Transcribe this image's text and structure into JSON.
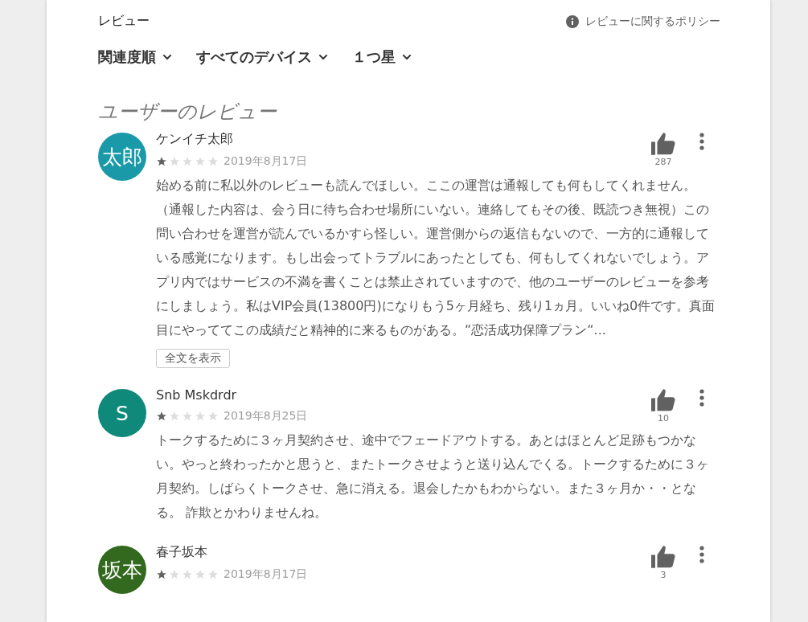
{
  "header": {
    "title": "レビュー",
    "policy_link": "レビューに関するポリシー"
  },
  "filters": [
    {
      "label": "関連度順"
    },
    {
      "label": "すべてのデバイス"
    },
    {
      "label": "１つ星"
    }
  ],
  "section_title": "ユーザーのレビュー",
  "reviews": [
    {
      "avatar_text": "太郎",
      "color": "#1a9aa9",
      "name": "ケンイチ太郎",
      "stars": 1,
      "date": "2019年8月17日",
      "likes": "287",
      "text": "始める前に私以外のレビューも読んでほしい。ここの運営は通報しても何もしてくれません。（通報した内容は、会う日に待ち合わせ場所にいない。連絡してもその後、既読つき無視）この問い合わせを運営が読んでいるかすら怪しい。運営側からの返信もないので、一方的に通報している感覚になります。もし出会ってトラブルにあったとしても、何もしてくれないでしょう。アプリ内ではサービスの不満を書くことは禁止されていますので、他のユーザーのレビューを参考にしましょう。私はVIP会員(13800円)になりもう5ヶ月経ち、残り1ヵ月。いいね0件です。真面目にやっててこの成績だと精神的に来るものがある。“恋活成功保障プラン“...",
      "full_button": "全文を表示"
    },
    {
      "avatar_text": "S",
      "color": "#0f8a7a",
      "name": "Snb Mskdrdr",
      "stars": 1,
      "date": "2019年8月25日",
      "likes": "10",
      "text": "トークするために３ヶ月契約させ、途中でフェードアウトする。あとはほとんど足跡もつかない。やっと終わったかと思うと、またトークさせようと送り込んでくる。トークするために３ヶ月契約。しばらくトークさせ、急に消える。退会したかもわからない。また３ヶ月か・・となる。 詐欺とかわりませんね。"
    },
    {
      "avatar_text": "坂本",
      "color": "#33691e",
      "name": "春子坂本",
      "stars": 1,
      "date": "2019年8月17日",
      "likes": "3"
    }
  ]
}
